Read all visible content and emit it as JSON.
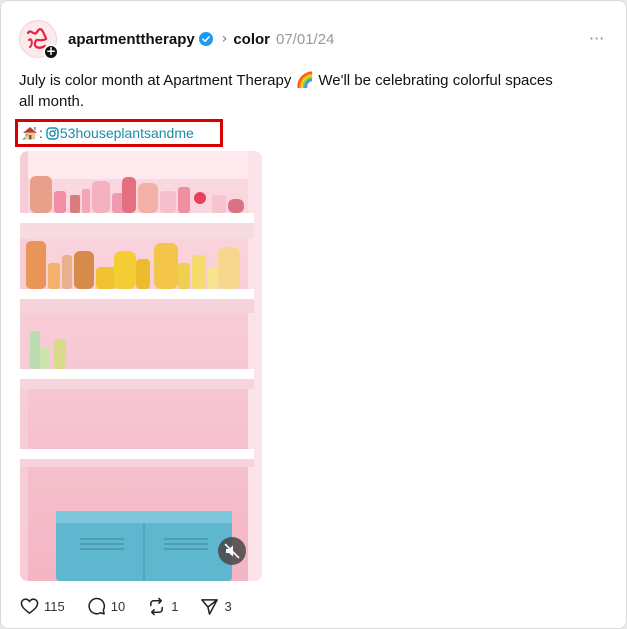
{
  "post": {
    "username": "apartmenttherapy",
    "topic": "color",
    "date": "07/01/24",
    "text": "July is color month at Apartment Therapy 🌈 We'll be celebrating colorful spaces all month.",
    "credit_colon": ":",
    "credit_handle": "53houseplantsandme"
  },
  "actions": {
    "likes": "115",
    "comments": "10",
    "reposts": "1",
    "shares": "3"
  },
  "icons": {
    "avatar": "apartment-therapy-logo-icon",
    "verified": "verified-badge-icon",
    "more": "more-options-icon",
    "house": "house-emoji-icon",
    "instagram": "instagram-icon",
    "mute": "muted-speaker-icon",
    "like": "heart-icon",
    "comment": "comment-icon",
    "repost": "repost-icon",
    "share": "share-icon"
  },
  "colors": {
    "verified": "#1d9bf0",
    "handle": "#1a8ca8",
    "highlight_box": "#d60000",
    "shelf_wall": "#f7c7d2",
    "cabinet": "#5fb7cf"
  }
}
